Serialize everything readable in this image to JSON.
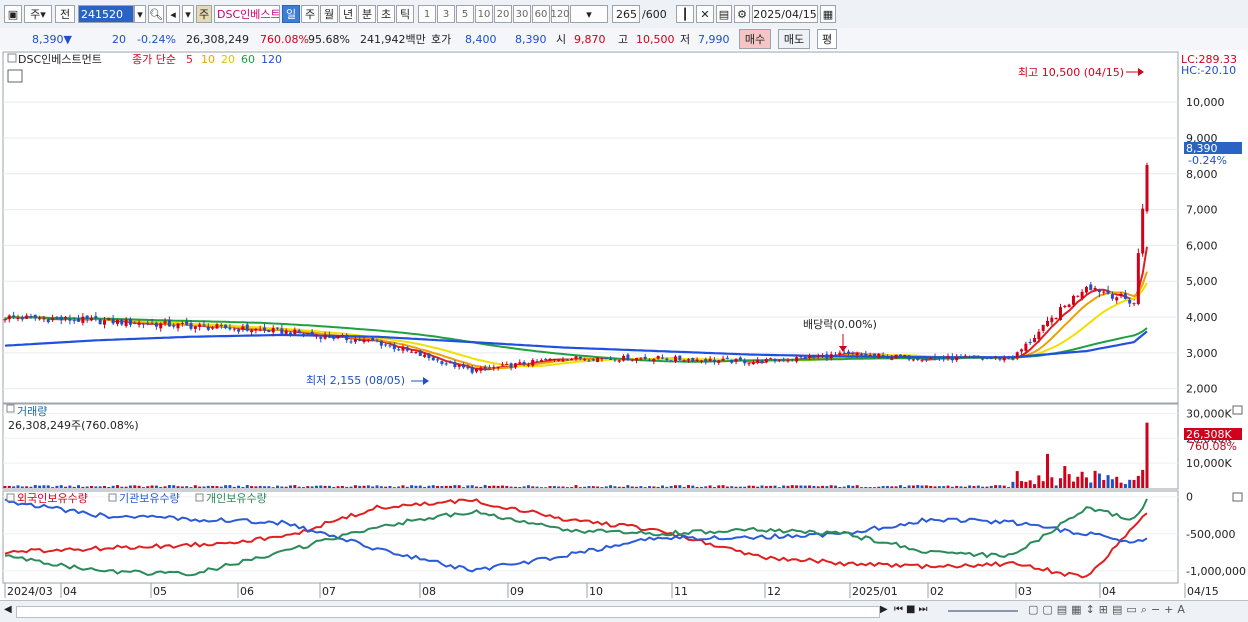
{
  "toolbar": {
    "type_main": "주",
    "type_sub": "전",
    "code": "241520",
    "name": "DSC인베스트먼",
    "periods": [
      "일",
      "주",
      "월",
      "년",
      "분",
      "초",
      "틱"
    ],
    "intervals": [
      "1",
      "3",
      "5",
      "10",
      "20",
      "30",
      "60",
      "120"
    ],
    "count": "265",
    "count_total": "/600",
    "date": "2025/04/15"
  },
  "quote": {
    "price": "8,390▼",
    "change": "20",
    "change_pct": "-0.24%",
    "volume": "26,308,249",
    "volume_ratio": "760.08%",
    "turnover": "95.68%",
    "amount": "241,942백만",
    "bidask_label": "호가",
    "bid": "8,400",
    "ask": "8,390",
    "open_label": "시",
    "open": "9,870",
    "high_label": "고",
    "high": "10,500",
    "low_label": "저",
    "low": "7,990",
    "buy_label": "매수",
    "sell_label": "매도",
    "avg_label": "평"
  },
  "legend": {
    "name": "DSC인베스트먼트",
    "ma_label": "종가 단순",
    "ma_periods": [
      "5",
      "10",
      "20",
      "60",
      "120"
    ],
    "ma_colors": [
      "#e02020",
      "#f0a000",
      "#f0e000",
      "#20a040",
      "#2050e0"
    ]
  },
  "price_panel": {
    "lc": "LC:289.33",
    "hc": "HC:-20.10",
    "high_note": "최고 10,500 (04/15)",
    "low_note": "최저 2,155 (08/05)",
    "dividend_note": "배당락(0.00%)",
    "last_price_tag": "8,390",
    "last_change_tag": "-0.24%"
  },
  "volume_panel": {
    "title": "거래량",
    "value_label": "26,308,249주(760.08%)",
    "last_tag": "26,308K",
    "last_tag_pct": "760.08%"
  },
  "holder_panel": {
    "foreign_label": "외국인보유수량",
    "inst_label": "기관보유수량",
    "indiv_label": "개인보유수량"
  },
  "x_labels": [
    "2024/03",
    "04",
    "05",
    "06",
    "07",
    "08",
    "09",
    "10",
    "11",
    "12",
    "2025/01",
    "02",
    "03",
    "04",
    "04/15"
  ],
  "chart_data": [
    {
      "type": "line",
      "title": "DSC인베스트먼트",
      "y_axis_ticks": [
        2000,
        3000,
        4000,
        5000,
        6000,
        7000,
        8000,
        9000,
        10000
      ],
      "ylim": [
        1600,
        11400
      ],
      "x": [
        "2024/03",
        "04",
        "05",
        "06",
        "07",
        "08",
        "09",
        "10",
        "11",
        "12",
        "2025/01",
        "02",
        "03",
        "04",
        "04/15"
      ],
      "series": [
        {
          "name": "종가",
          "values": [
            4000,
            3900,
            3750,
            3600,
            3300,
            2500,
            2850,
            2850,
            2750,
            2950,
            2850,
            2850,
            4900,
            4400,
            8390
          ]
        },
        {
          "name": "120",
          "values": [
            3200,
            3350,
            3450,
            3500,
            3450,
            3300,
            3150,
            3050,
            2950,
            2900,
            2880,
            2880,
            3050,
            3300,
            3600
          ]
        }
      ],
      "annotations": {
        "high": "최고 10,500 (04/15)",
        "low": "최저 2,155 (08/05)",
        "dividend": "배당락(0.00%)"
      }
    },
    {
      "type": "bar",
      "title": "거래량",
      "y_axis_ticks": [
        10000,
        20000,
        30000
      ],
      "y_tick_labels": [
        "10,000K",
        "20,000K",
        "30,000K"
      ],
      "last_value": 26308249
    },
    {
      "type": "line",
      "title": "보유수량",
      "y_axis_ticks": [
        0,
        -500000,
        -1000000
      ],
      "y_tick_labels": [
        "0",
        "-500,000",
        "-1,000,000"
      ],
      "series": [
        {
          "name": "외국인보유수량",
          "color": "#e02020"
        },
        {
          "name": "기관보유수량",
          "color": "#2a5ad6"
        },
        {
          "name": "개인보유수량",
          "color": "#2a8a5a"
        }
      ]
    }
  ]
}
